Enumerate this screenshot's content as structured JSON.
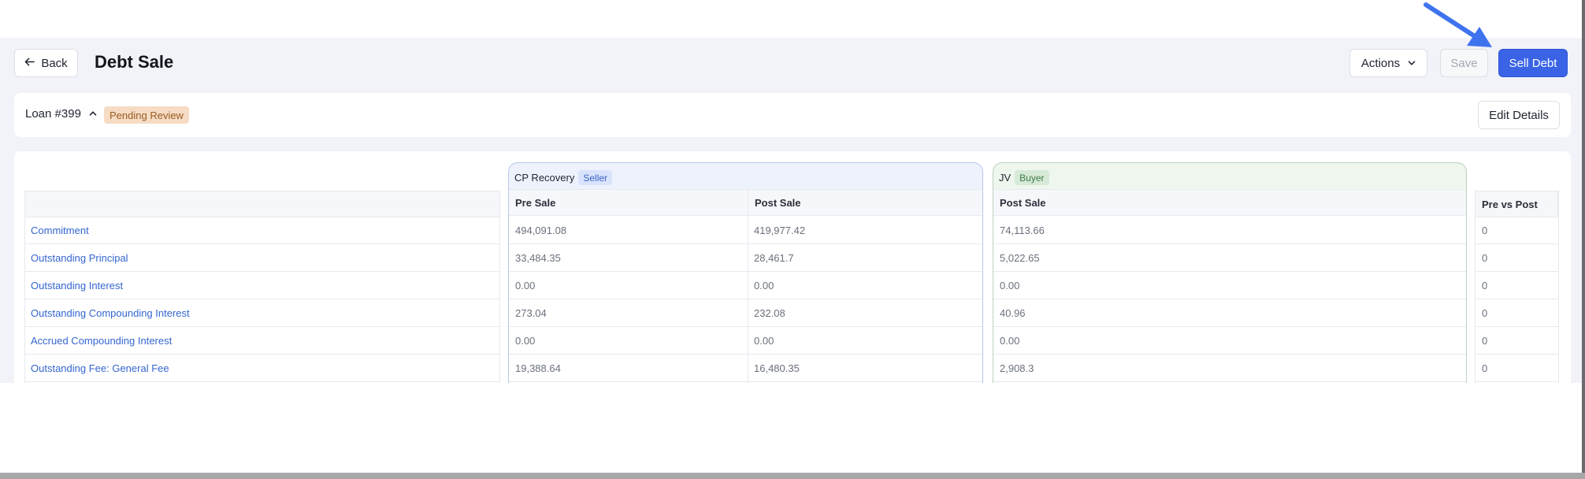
{
  "header": {
    "back_label": "Back",
    "title": "Debt Sale",
    "actions_label": "Actions",
    "save_label": "Save",
    "sell_label": "Sell Debt"
  },
  "loan": {
    "label": "Loan #399",
    "status": "Pending Review",
    "edit_label": "Edit Details"
  },
  "table": {
    "seller_group": {
      "name": "CP Recovery",
      "tag": "Seller"
    },
    "buyer_group": {
      "name": "JV",
      "tag": "Buyer"
    },
    "columns": [
      "Pre Sale",
      "Post Sale",
      "Post Sale",
      "Pre vs Post"
    ],
    "rows": [
      {
        "label": "Commitment",
        "seller_pre": "494,091.08",
        "seller_post": "419,977.42",
        "buyer_post": "74,113.66",
        "diff": "0"
      },
      {
        "label": "Outstanding Principal",
        "seller_pre": "33,484.35",
        "seller_post": "28,461.7",
        "buyer_post": "5,022.65",
        "diff": "0"
      },
      {
        "label": "Outstanding Interest",
        "seller_pre": "0.00",
        "seller_post": "0.00",
        "buyer_post": "0.00",
        "diff": "0"
      },
      {
        "label": "Outstanding Compounding Interest",
        "seller_pre": "273.04",
        "seller_post": "232.08",
        "buyer_post": "40.96",
        "diff": "0"
      },
      {
        "label": "Accrued Compounding Interest",
        "seller_pre": "0.00",
        "seller_post": "0.00",
        "buyer_post": "0.00",
        "diff": "0"
      },
      {
        "label": "Outstanding Fee: General Fee",
        "seller_pre": "19,388.64",
        "seller_post": "16,480.35",
        "buyer_post": "2,908.3",
        "diff": "0"
      }
    ]
  },
  "colors": {
    "primary": "#3a63e6",
    "link": "#3466cf",
    "pending_badge_bg": "#f6dcc4",
    "arrow": "#3f73ee"
  },
  "icons": {
    "back": "arrow-left-icon",
    "actions": "chevron-down-icon",
    "loan_toggle": "chevron-up-icon",
    "pointer": "pointer-arrow-icon"
  }
}
